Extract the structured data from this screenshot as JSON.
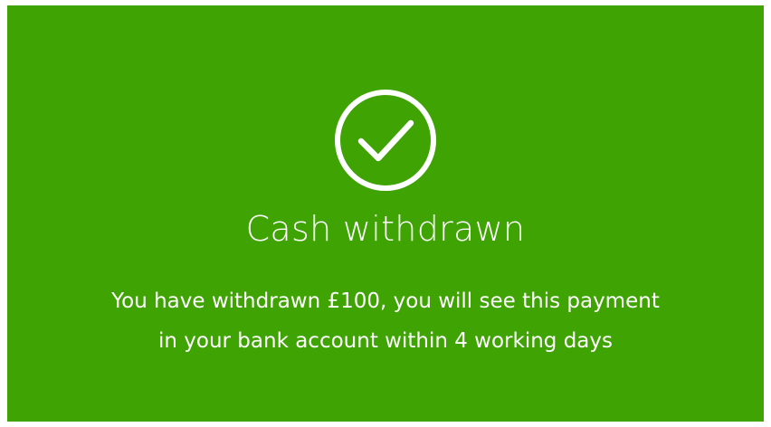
{
  "status": {
    "icon": "check-circle-icon",
    "title": "Cash withdrawn",
    "message_line_1": "You have withdrawn £100, you will see this payment",
    "message_line_2": "in your bank account within 4 working days"
  },
  "colors": {
    "panel_background": "#3ea303",
    "text": "#ffffff"
  }
}
